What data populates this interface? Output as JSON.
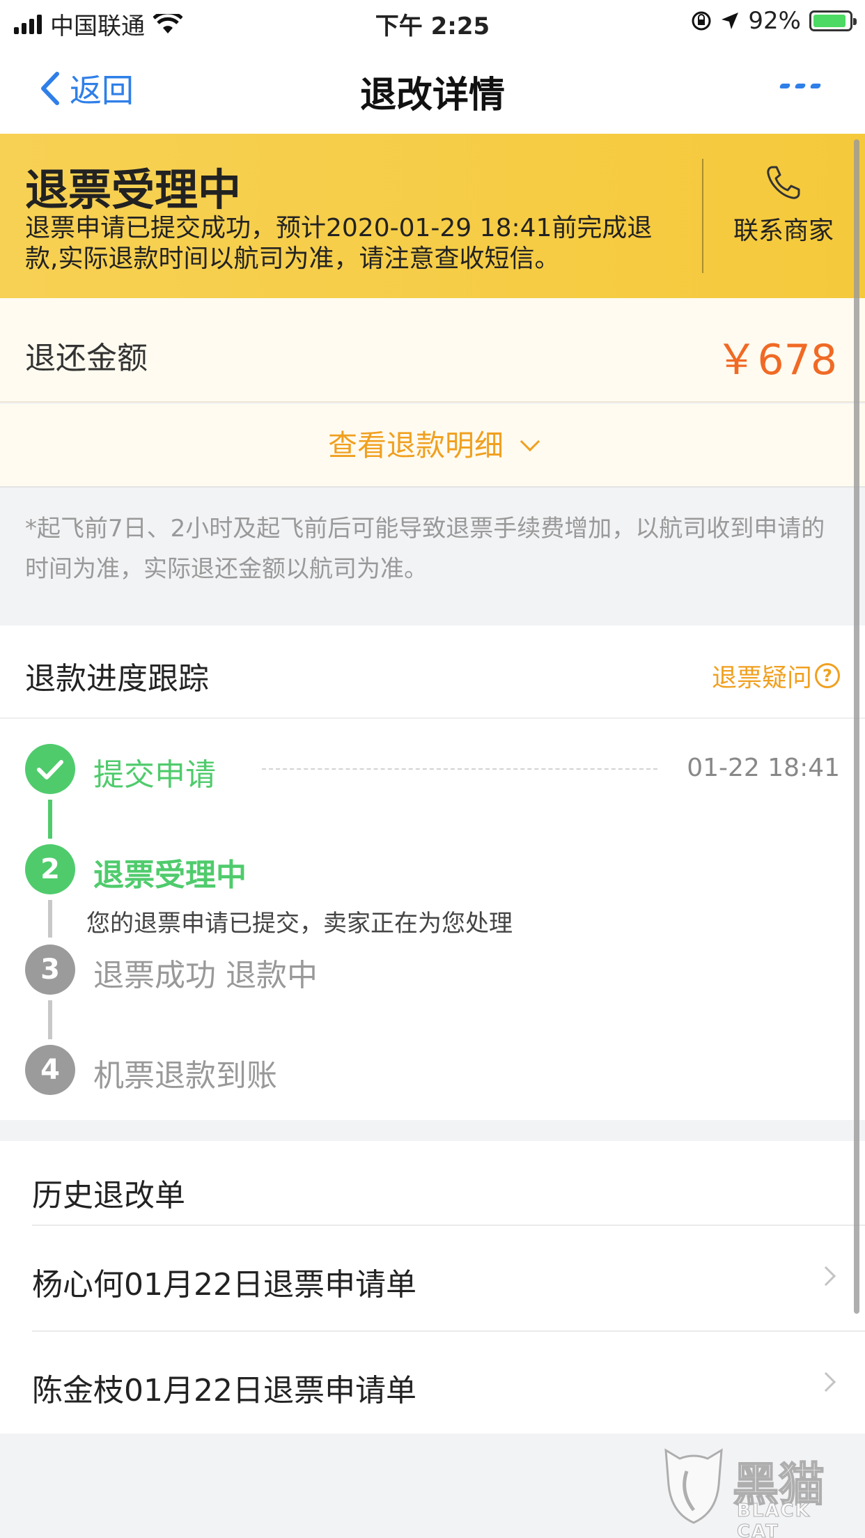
{
  "status_bar": {
    "carrier": "中国联通",
    "time": "下午 2:25",
    "battery": "92%",
    "battery_level": 0.92
  },
  "nav": {
    "back_label": "返回",
    "title": "退改详情",
    "more_icon": "ellipsis-icon"
  },
  "banner": {
    "title": "退票受理中",
    "description": "退票申请已提交成功，预计2020-01-29 18:41前完成退款,实际退款时间以航司为准，请注意查收短信。",
    "contact_label": "联系商家",
    "contact_icon": "phone-icon",
    "color": "#f6cf4a"
  },
  "refund": {
    "label": "退还金额",
    "amount": "￥678",
    "detail_link": "查看退款明细",
    "accent": "#f06a25"
  },
  "note": "*起飞前7日、2小时及起飞前后可能导致退票手续费增加，以航司收到申请的时间为准，实际退还金额以航司为准。",
  "progress": {
    "title": "退款进度跟踪",
    "question_link": "退票疑问",
    "steps": [
      {
        "number": "",
        "label": "提交申请",
        "time": "01-22 18:41",
        "state": "done"
      },
      {
        "number": "2",
        "label": "退票受理中",
        "desc": "您的退票申请已提交，卖家正在为您处理",
        "state": "active"
      },
      {
        "number": "3",
        "label": "退票成功 退款中",
        "state": "pending"
      },
      {
        "number": "4",
        "label": "机票退款到账",
        "state": "pending"
      }
    ]
  },
  "history": {
    "title": "历史退改单",
    "items": [
      {
        "label": "杨心何01月22日退票申请单"
      },
      {
        "label": "陈金枝01月22日退票申请单"
      }
    ]
  },
  "watermark": {
    "text": "黑猫",
    "sub": "BLACK CAT"
  }
}
